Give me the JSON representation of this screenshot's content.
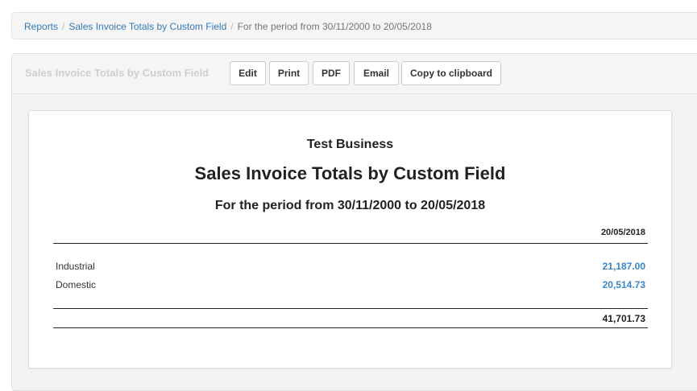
{
  "breadcrumb": {
    "items": [
      {
        "label": "Reports"
      },
      {
        "label": "Sales Invoice Totals by Custom Field"
      }
    ],
    "current": "For the period from 30/11/2000 to 20/05/2018"
  },
  "toolbar": {
    "title": "Sales Invoice Totals by Custom Field",
    "buttons": {
      "edit": "Edit",
      "print": "Print",
      "pdf": "PDF",
      "email": "Email",
      "copy": "Copy to clipboard"
    }
  },
  "report": {
    "business_name": "Test Business",
    "title": "Sales Invoice Totals by Custom Field",
    "period": "For the period from 30/11/2000 to 20/05/2018",
    "column_header": "20/05/2018",
    "rows": [
      {
        "label": "Industrial",
        "value": "21,187.00"
      },
      {
        "label": "Domestic",
        "value": "20,514.73"
      }
    ],
    "total": "41,701.73"
  },
  "colors": {
    "link": "#337ab7",
    "value_link": "#3a86c8"
  }
}
